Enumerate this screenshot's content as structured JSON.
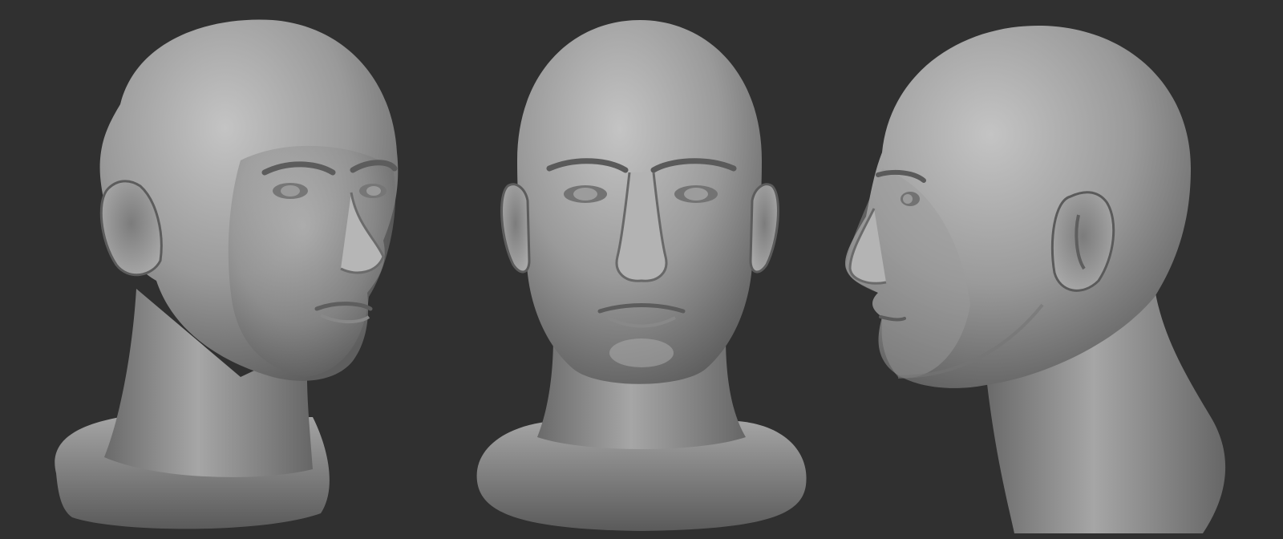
{
  "scene": {
    "background_color": "#303030",
    "material_color": "#a2a2a2",
    "views": [
      {
        "name": "three-quarter-right",
        "icon": "head-sculpt"
      },
      {
        "name": "front",
        "icon": "head-sculpt"
      },
      {
        "name": "left-profile",
        "icon": "head-sculpt"
      }
    ]
  }
}
